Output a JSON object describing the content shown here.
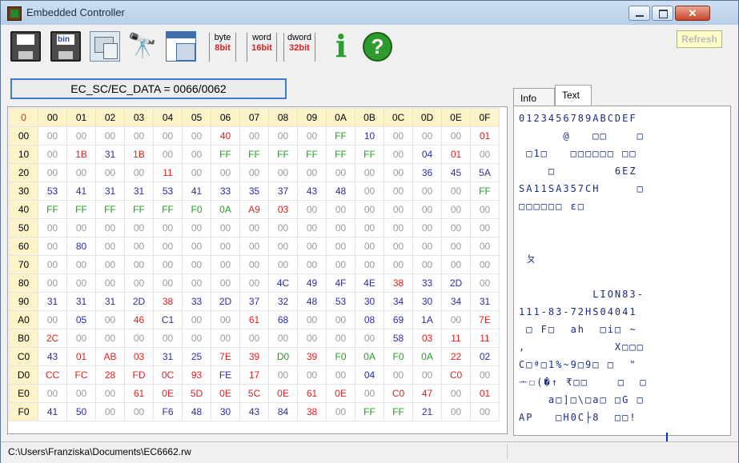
{
  "window": {
    "title": "Embedded Controller",
    "close_glyph": "✕"
  },
  "toolbar": {
    "bin_label": "bin",
    "byte_unit": "byte",
    "byte_bits": "8bit",
    "word_unit": "word",
    "word_bits": "16bit",
    "dword_unit": "dword",
    "dword_bits": "32bit",
    "info_glyph": "i",
    "help_glyph": "?",
    "refresh_label": "Refresh",
    "icons": [
      "save-floppy-icon",
      "save-bin-icon",
      "pc-config-icon",
      "binoculars-icon",
      "window-layout-icon",
      "info-icon",
      "help-icon"
    ]
  },
  "ec_field": {
    "value": "EC_SC/EC_DATA = 0066/0062"
  },
  "hex": {
    "corner": "0",
    "columns": [
      "00",
      "01",
      "02",
      "03",
      "04",
      "05",
      "06",
      "07",
      "08",
      "09",
      "0A",
      "0B",
      "0C",
      "0D",
      "0E",
      "0F"
    ],
    "rows": [
      {
        "addr": "00",
        "cells": [
          "00",
          "00",
          "00",
          "00",
          "00",
          "00",
          "40",
          "00",
          "00",
          "00",
          "FF",
          "10",
          "00",
          "00",
          "00",
          "01"
        ]
      },
      {
        "addr": "10",
        "cells": [
          "00",
          "1B",
          "31",
          "1B",
          "00",
          "00",
          "FF",
          "FF",
          "FF",
          "FF",
          "FF",
          "FF",
          "00",
          "04",
          "01",
          "00"
        ]
      },
      {
        "addr": "20",
        "cells": [
          "00",
          "00",
          "00",
          "00",
          "11",
          "00",
          "00",
          "00",
          "00",
          "00",
          "00",
          "00",
          "00",
          "36",
          "45",
          "5A"
        ]
      },
      {
        "addr": "30",
        "cells": [
          "53",
          "41",
          "31",
          "31",
          "53",
          "41",
          "33",
          "35",
          "37",
          "43",
          "48",
          "00",
          "00",
          "00",
          "00",
          "FF"
        ]
      },
      {
        "addr": "40",
        "cells": [
          "FF",
          "FF",
          "FF",
          "FF",
          "FF",
          "F0",
          "0A",
          "A9",
          "03",
          "00",
          "00",
          "00",
          "00",
          "00",
          "00",
          "00"
        ]
      },
      {
        "addr": "50",
        "cells": [
          "00",
          "00",
          "00",
          "00",
          "00",
          "00",
          "00",
          "00",
          "00",
          "00",
          "00",
          "00",
          "00",
          "00",
          "00",
          "00"
        ]
      },
      {
        "addr": "60",
        "cells": [
          "00",
          "80",
          "00",
          "00",
          "00",
          "00",
          "00",
          "00",
          "00",
          "00",
          "00",
          "00",
          "00",
          "00",
          "00",
          "00"
        ]
      },
      {
        "addr": "70",
        "cells": [
          "00",
          "00",
          "00",
          "00",
          "00",
          "00",
          "00",
          "00",
          "00",
          "00",
          "00",
          "00",
          "00",
          "00",
          "00",
          "00"
        ]
      },
      {
        "addr": "80",
        "cells": [
          "00",
          "00",
          "00",
          "00",
          "00",
          "00",
          "00",
          "00",
          "4C",
          "49",
          "4F",
          "4E",
          "38",
          "33",
          "2D",
          "00"
        ]
      },
      {
        "addr": "90",
        "cells": [
          "31",
          "31",
          "31",
          "2D",
          "38",
          "33",
          "2D",
          "37",
          "32",
          "48",
          "53",
          "30",
          "34",
          "30",
          "34",
          "31"
        ]
      },
      {
        "addr": "A0",
        "cells": [
          "00",
          "05",
          "00",
          "46",
          "C1",
          "00",
          "00",
          "61",
          "68",
          "00",
          "00",
          "08",
          "69",
          "1A",
          "00",
          "7E"
        ]
      },
      {
        "addr": "B0",
        "cells": [
          "2C",
          "00",
          "00",
          "00",
          "00",
          "00",
          "00",
          "00",
          "00",
          "00",
          "00",
          "00",
          "58",
          "03",
          "11",
          "11"
        ]
      },
      {
        "addr": "C0",
        "cells": [
          "43",
          "01",
          "AB",
          "03",
          "31",
          "25",
          "7E",
          "39",
          "D0",
          "39",
          "F0",
          "0A",
          "F0",
          "0A",
          "22",
          "02"
        ]
      },
      {
        "addr": "D0",
        "cells": [
          "CC",
          "FC",
          "28",
          "FD",
          "0C",
          "93",
          "FE",
          "17",
          "00",
          "00",
          "00",
          "04",
          "00",
          "00",
          "C0",
          "00"
        ]
      },
      {
        "addr": "E0",
        "cells": [
          "00",
          "00",
          "00",
          "61",
          "0E",
          "5D",
          "0E",
          "5C",
          "0E",
          "61",
          "0E",
          "00",
          "C0",
          "47",
          "00",
          "01"
        ]
      },
      {
        "addr": "F0",
        "cells": [
          "41",
          "50",
          "00",
          "00",
          "F6",
          "48",
          "30",
          "43",
          "84",
          "38",
          "00",
          "FF",
          "FF",
          "21",
          "00",
          "00"
        ]
      }
    ],
    "colors": {
      "zero": "#9a9a9a",
      "red": "#e02020",
      "green": "#1e9e1e",
      "blue": "#2b2ba8",
      "red_values": [
        "40",
        "1B",
        "A9",
        "03",
        "46",
        "2C",
        "11",
        "01",
        "AB",
        "7E",
        "39",
        "22",
        "CC",
        "FC",
        "28",
        "FD",
        "0C",
        "93",
        "17",
        "C0",
        "47",
        "61",
        "5D",
        "5C",
        "0E",
        "38",
        "A0"
      ],
      "green_values": [
        "FF",
        "F0",
        "0A",
        "D0",
        "F0"
      ]
    }
  },
  "tabs": {
    "info": "Info",
    "text": "Text"
  },
  "text_panel": {
    "lines": [
      "0123456789ABCDEF",
      "      @   □□    □",
      " □1□   □□□□□□ □□",
      "    □        6EZ",
      "SA11SA357CH     □",
      "□□□□□□ ɛ□",
      "",
      "",
      " ㄆ",
      "",
      "          LION83-",
      "111-83-72HS04041",
      " □ F□  ah  □i□ ~",
      ",            X□□□",
      "C□ª□1%~9□9□ □  \"",
      "ᅩ☐(�↑ ₹□□    □  □",
      "    a□]□\\□a□ □G □",
      "AP   □H0C├8  □□!"
    ]
  },
  "status": {
    "path": "C:\\Users\\Franziska\\Documents\\EC6662.rw"
  }
}
